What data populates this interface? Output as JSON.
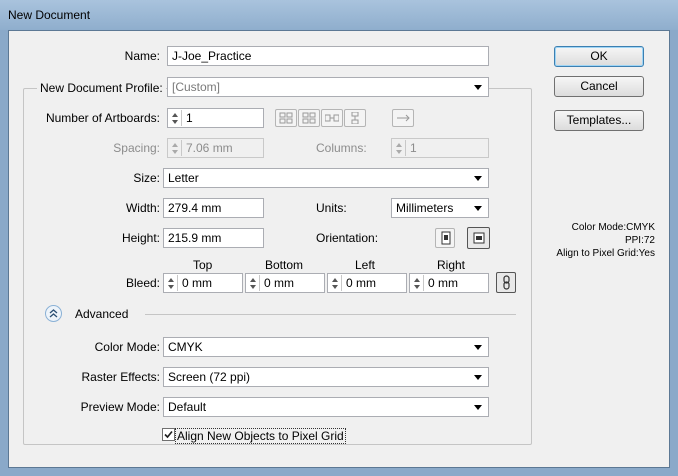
{
  "window": {
    "title": "New Document"
  },
  "name": {
    "label": "Name:",
    "value": "J-Joe_Practice"
  },
  "profile": {
    "label": "New Document Profile:",
    "value": "[Custom]"
  },
  "artboards": {
    "label": "Number of Artboards:",
    "value": "1"
  },
  "spacing": {
    "label": "Spacing:",
    "value": "7.06 mm"
  },
  "columns": {
    "label": "Columns:",
    "value": "1"
  },
  "size": {
    "label": "Size:",
    "value": "Letter"
  },
  "width": {
    "label": "Width:",
    "value": "279.4 mm"
  },
  "units": {
    "label": "Units:",
    "value": "Millimeters"
  },
  "height": {
    "label": "Height:",
    "value": "215.9 mm"
  },
  "orientation": {
    "label": "Orientation:"
  },
  "bleed": {
    "label": "Bleed:",
    "top_label": "Top",
    "bottom_label": "Bottom",
    "left_label": "Left",
    "right_label": "Right",
    "top": "0 mm",
    "bottom": "0 mm",
    "left": "0 mm",
    "right": "0 mm"
  },
  "advanced": {
    "label": "Advanced"
  },
  "color_mode": {
    "label": "Color Mode:",
    "value": "CMYK"
  },
  "raster_effects": {
    "label": "Raster Effects:",
    "value": "Screen (72 ppi)"
  },
  "preview_mode": {
    "label": "Preview Mode:",
    "value": "Default"
  },
  "pixel_grid": {
    "label": "Align New Objects to Pixel Grid",
    "checked": true
  },
  "buttons": {
    "ok": "OK",
    "cancel": "Cancel",
    "templates": "Templates..."
  },
  "info": {
    "line1": "Color Mode:CMYK",
    "line2": "PPI:72",
    "line3": "Align to Pixel Grid:Yes"
  },
  "icons": [
    "grid-by-row-icon",
    "grid-by-column-icon",
    "arrange-by-row-icon",
    "arrange-by-column-icon",
    "right-to-left-icon",
    "portrait-icon",
    "landscape-icon",
    "link-icon",
    "chevron-up-icon",
    "checkmark-icon"
  ]
}
